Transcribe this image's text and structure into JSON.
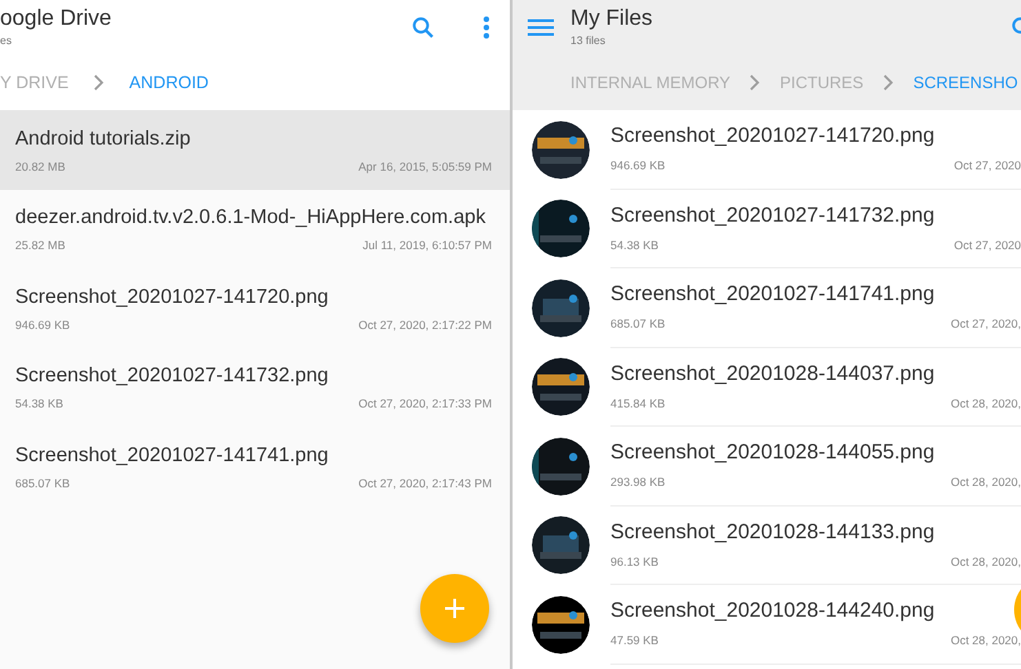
{
  "left_pane": {
    "title": "oogle Drive",
    "subtitle": "es",
    "breadcrumb": [
      {
        "label": "Y DRIVE",
        "selected": false
      },
      {
        "label": "ANDROID",
        "selected": true
      }
    ],
    "files": [
      {
        "name": "Android tutorials.zip",
        "size": "20.82 MB",
        "date": "Apr 16, 2015, 5:05:59 PM",
        "selected": true
      },
      {
        "name": "deezer.android.tv.v2.0.6.1-Mod-_HiAppHere.com.apk",
        "size": "25.82 MB",
        "date": "Jul 11, 2019, 6:10:57 PM",
        "selected": false
      },
      {
        "name": "Screenshot_20201027-141720.png",
        "size": "946.69 KB",
        "date": "Oct 27, 2020, 2:17:22 PM",
        "selected": false
      },
      {
        "name": "Screenshot_20201027-141732.png",
        "size": "54.38 KB",
        "date": "Oct 27, 2020, 2:17:33 PM",
        "selected": false
      },
      {
        "name": "Screenshot_20201027-141741.png",
        "size": "685.07 KB",
        "date": "Oct 27, 2020, 2:17:43 PM",
        "selected": false
      }
    ]
  },
  "right_pane": {
    "title": "My Files",
    "subtitle": "13 files",
    "breadcrumb": [
      {
        "label": "INTERNAL MEMORY",
        "selected": false
      },
      {
        "label": "PICTURES",
        "selected": false
      },
      {
        "label": "SCREENSHO",
        "selected": true
      }
    ],
    "files": [
      {
        "name": "Screenshot_20201027-141720.png",
        "size": "946.69 KB",
        "date": "Oct 27, 2020"
      },
      {
        "name": "Screenshot_20201027-141732.png",
        "size": "54.38 KB",
        "date": "Oct 27, 2020"
      },
      {
        "name": "Screenshot_20201027-141741.png",
        "size": "685.07 KB",
        "date": "Oct 27, 2020,"
      },
      {
        "name": "Screenshot_20201028-144037.png",
        "size": "415.84 KB",
        "date": "Oct 28, 2020,"
      },
      {
        "name": "Screenshot_20201028-144055.png",
        "size": "293.98 KB",
        "date": "Oct 28, 2020,"
      },
      {
        "name": "Screenshot_20201028-144133.png",
        "size": "96.13 KB",
        "date": "Oct 28, 2020,"
      },
      {
        "name": "Screenshot_20201028-144240.png",
        "size": "47.59 KB",
        "date": "Oct 28, 2020,"
      }
    ]
  }
}
